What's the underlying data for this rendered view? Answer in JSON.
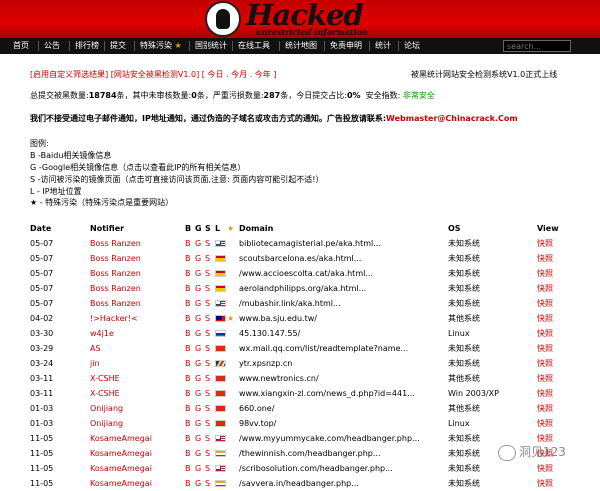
{
  "logo": {
    "word": "Hacked",
    "sub": "unrestricted information"
  },
  "nav": {
    "items": [
      "首页",
      "公告",
      "排行榜",
      "提交",
      "特殊污染",
      "国别统计",
      "在线工具",
      "统计地图",
      "免责申明",
      "统计",
      "论坛"
    ],
    "search_placeholder": "search..."
  },
  "links_line": {
    "link1": "[启用自定义筛选结果]",
    "link2": "[网站安全被黑检测V1.0]",
    "link3": "[ 今日 . 今月 . 今年 ]",
    "right": "被黑统计网站安全检测系统V1.0正式上线"
  },
  "stats": {
    "prefix": "总提交被黑数量:",
    "total": "18784",
    "mid1": "条，其中未审核数量:",
    "pending": "0",
    "mid2": "条，严重污损数量:",
    "severe": "287",
    "mid3": "条，今日提交占比:",
    "today_pct": "0%",
    "mid4": "安全指数:",
    "safety": "非常安全"
  },
  "notice": {
    "text": "我们不接受通过电子邮件通知，IP地址通知，通过伪造的子域名或攻击方式的通知。广告投放请联系:",
    "email": "Webmaster@Chinacrack.Com"
  },
  "legend": {
    "title": "图例:",
    "b": "B -Baidu相关镜像信息",
    "g": "G -Google相关镜像信息（点击以查看此IP的所有相关信息）",
    "s": "S -访问被污染的镜像页面（点击可直接访问该页面,注意: 页面内容可能引起不适!）",
    "l": "L - IP地址位置",
    "star": "★ - 特殊污染（特殊污染点是重要网站）"
  },
  "table": {
    "headers": {
      "date": "Date",
      "notifier": "Notifier",
      "b": "B",
      "g": "G",
      "s": "S",
      "l": "L",
      "star": "★",
      "domain": "Domain",
      "os": "OS",
      "view": "View"
    },
    "rows": [
      {
        "date": "05-07",
        "notifier": "Boss Ranzen",
        "star": "",
        "domain": "bibliotecamagisterial.pe/aka.html...",
        "os": "未知系统",
        "view": "快照",
        "flag": "us"
      },
      {
        "date": "05-07",
        "notifier": "Boss Ranzen",
        "star": "",
        "domain": "scoutsbarcelona.es/aka.html...",
        "os": "未知系统",
        "view": "快照",
        "flag": "es"
      },
      {
        "date": "05-07",
        "notifier": "Boss Ranzen",
        "star": "",
        "domain": "/www.accioescolta.cat/aka.html...",
        "os": "未知系统",
        "view": "快照",
        "flag": "es"
      },
      {
        "date": "05-07",
        "notifier": "Boss Ranzen",
        "star": "",
        "domain": "aerolandphilipps.org/aka.html...",
        "os": "未知系统",
        "view": "快照",
        "flag": "es"
      },
      {
        "date": "05-07",
        "notifier": "Boss Ranzen",
        "star": "",
        "domain": "/mubashir.link/aka.html...",
        "os": "未知系统",
        "view": "快照",
        "flag": "us"
      },
      {
        "date": "04-02",
        "notifier": "!>Hacker!<",
        "star": "★",
        "domain": "www.ba.sju.edu.tw/",
        "os": "其他系统",
        "view": "快照",
        "flag": "tw"
      },
      {
        "date": "03-30",
        "notifier": "w4j1e",
        "star": "",
        "domain": "45.130.147.55/",
        "os": "Linux",
        "view": "快照",
        "flag": "ru"
      },
      {
        "date": "03-29",
        "notifier": "AS",
        "star": "",
        "domain": "wx.mail.qq.com/list/readtemplate?name...",
        "os": "未知系统",
        "view": "快照",
        "flag": "cn"
      },
      {
        "date": "03-24",
        "notifier": "jin",
        "star": "",
        "domain": "ytr.xpsnzp.cn",
        "os": "未知系统",
        "view": "快照",
        "flag": "sc"
      },
      {
        "date": "03-11",
        "notifier": "X-CSHE",
        "star": "",
        "domain": "www.newtronics.cn/",
        "os": "其他系统",
        "view": "快照",
        "flag": "cn"
      },
      {
        "date": "03-11",
        "notifier": "X-CSHE",
        "star": "",
        "domain": "www.xiangxin-zl.com/news_d.php?id=441...",
        "os": "Win 2003/XP",
        "view": "快照",
        "flag": "cn"
      },
      {
        "date": "01-03",
        "notifier": "Onijiang",
        "star": "",
        "domain": "660.one/",
        "os": "其他系统",
        "view": "快照",
        "flag": "hk"
      },
      {
        "date": "01-03",
        "notifier": "Onijiang",
        "star": "",
        "domain": "98vv.top/",
        "os": "Linux",
        "view": "快照",
        "flag": "hk"
      },
      {
        "date": "11-05",
        "notifier": "KosameAmegai",
        "star": "",
        "domain": "/www.myyummycake.com/headbanger.php...",
        "os": "未知系统",
        "view": "快照",
        "flag": "us"
      },
      {
        "date": "11-05",
        "notifier": "KosameAmegai",
        "star": "",
        "domain": "/thewinnish.com/headbanger.php...",
        "os": "未知系统",
        "view": "快照",
        "flag": "in"
      },
      {
        "date": "11-05",
        "notifier": "KosameAmegai",
        "star": "",
        "domain": "/scribosolution.com/headbanger.php...",
        "os": "未知系统",
        "view": "快照",
        "flag": "us"
      },
      {
        "date": "11-05",
        "notifier": "KosameAmegai",
        "star": "",
        "domain": "/savvera.in/headbanger.php...",
        "os": "未知系统",
        "view": "快照",
        "flag": "in"
      }
    ]
  },
  "watermark": {
    "text": "洞见123"
  },
  "colors": {
    "banner": "#cc0000",
    "nav_bg": "#111111",
    "link_red": "#cc0000",
    "safe_green": "#009900",
    "star_gold": "#d4a017"
  }
}
